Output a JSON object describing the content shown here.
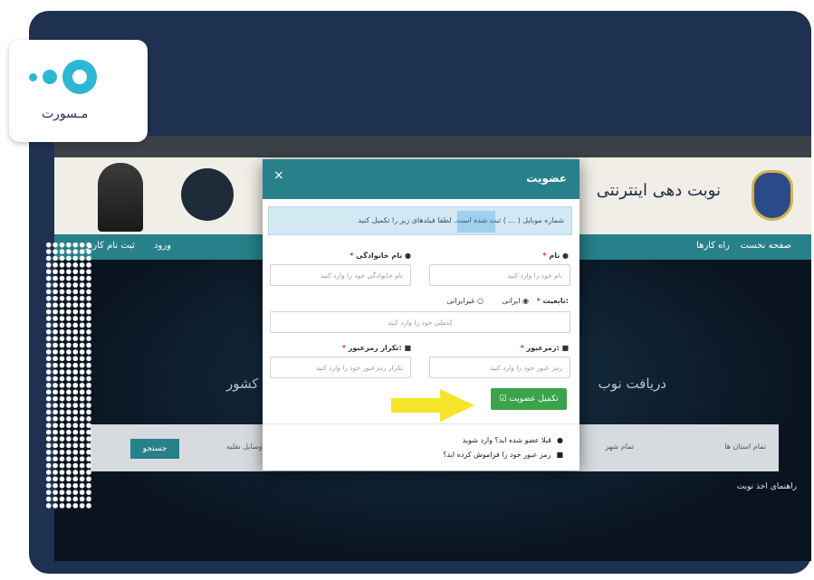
{
  "logo": {
    "text": "مـسورت"
  },
  "site": {
    "header_title": "نوبت دهی اینترنتی",
    "nav": {
      "home": "صفحه نخست",
      "guides": "راه کارها",
      "login": "ورود",
      "register": "ثبت نام کاربر"
    },
    "hero_right": "دریافت نوب",
    "hero_left": "دروبی کشور",
    "search": {
      "field1": "تمام استان ها",
      "field2": "تمام شهر",
      "field3": "وسایل نقلیه",
      "button": "جستجو"
    },
    "guide": "راهنمای اخذ نوبت"
  },
  "modal": {
    "title": "عضویت",
    "close": "×",
    "alert": "شماره موبایل ( ... ) ثبت شده است. لطفا فیلدهای زیر را تکمیل کنید",
    "first_name_label": "نام",
    "first_name_placeholder": "نام خود را وارد کنید",
    "last_name_label": "نام خانوادگی",
    "last_name_placeholder": "نام خانوادگی خود را وارد کنید",
    "nationality_label": "تابعیت:",
    "iranian": "ایرانی",
    "non_iranian": "غیرایرانی",
    "national_code_placeholder": "کدملی خود را وارد کنید",
    "password_label": "رمزعبور:",
    "password_placeholder": "رمز عبور خود را وارد کنید",
    "confirm_label": "تکرار رمزعبور:",
    "confirm_placeholder": "تکرار رمزعبور خود را وارد کنید",
    "submit": "تکمیل عضویت",
    "already_member": "قبلا عضو شده اید؟ وارد شوید",
    "forgot": "رمز عبور خود را فراموش کرده اید؟"
  },
  "colors": {
    "frame": "#1f3150",
    "accent": "#27808a",
    "submit": "#3ba44a",
    "arrow": "#f5e52a"
  }
}
